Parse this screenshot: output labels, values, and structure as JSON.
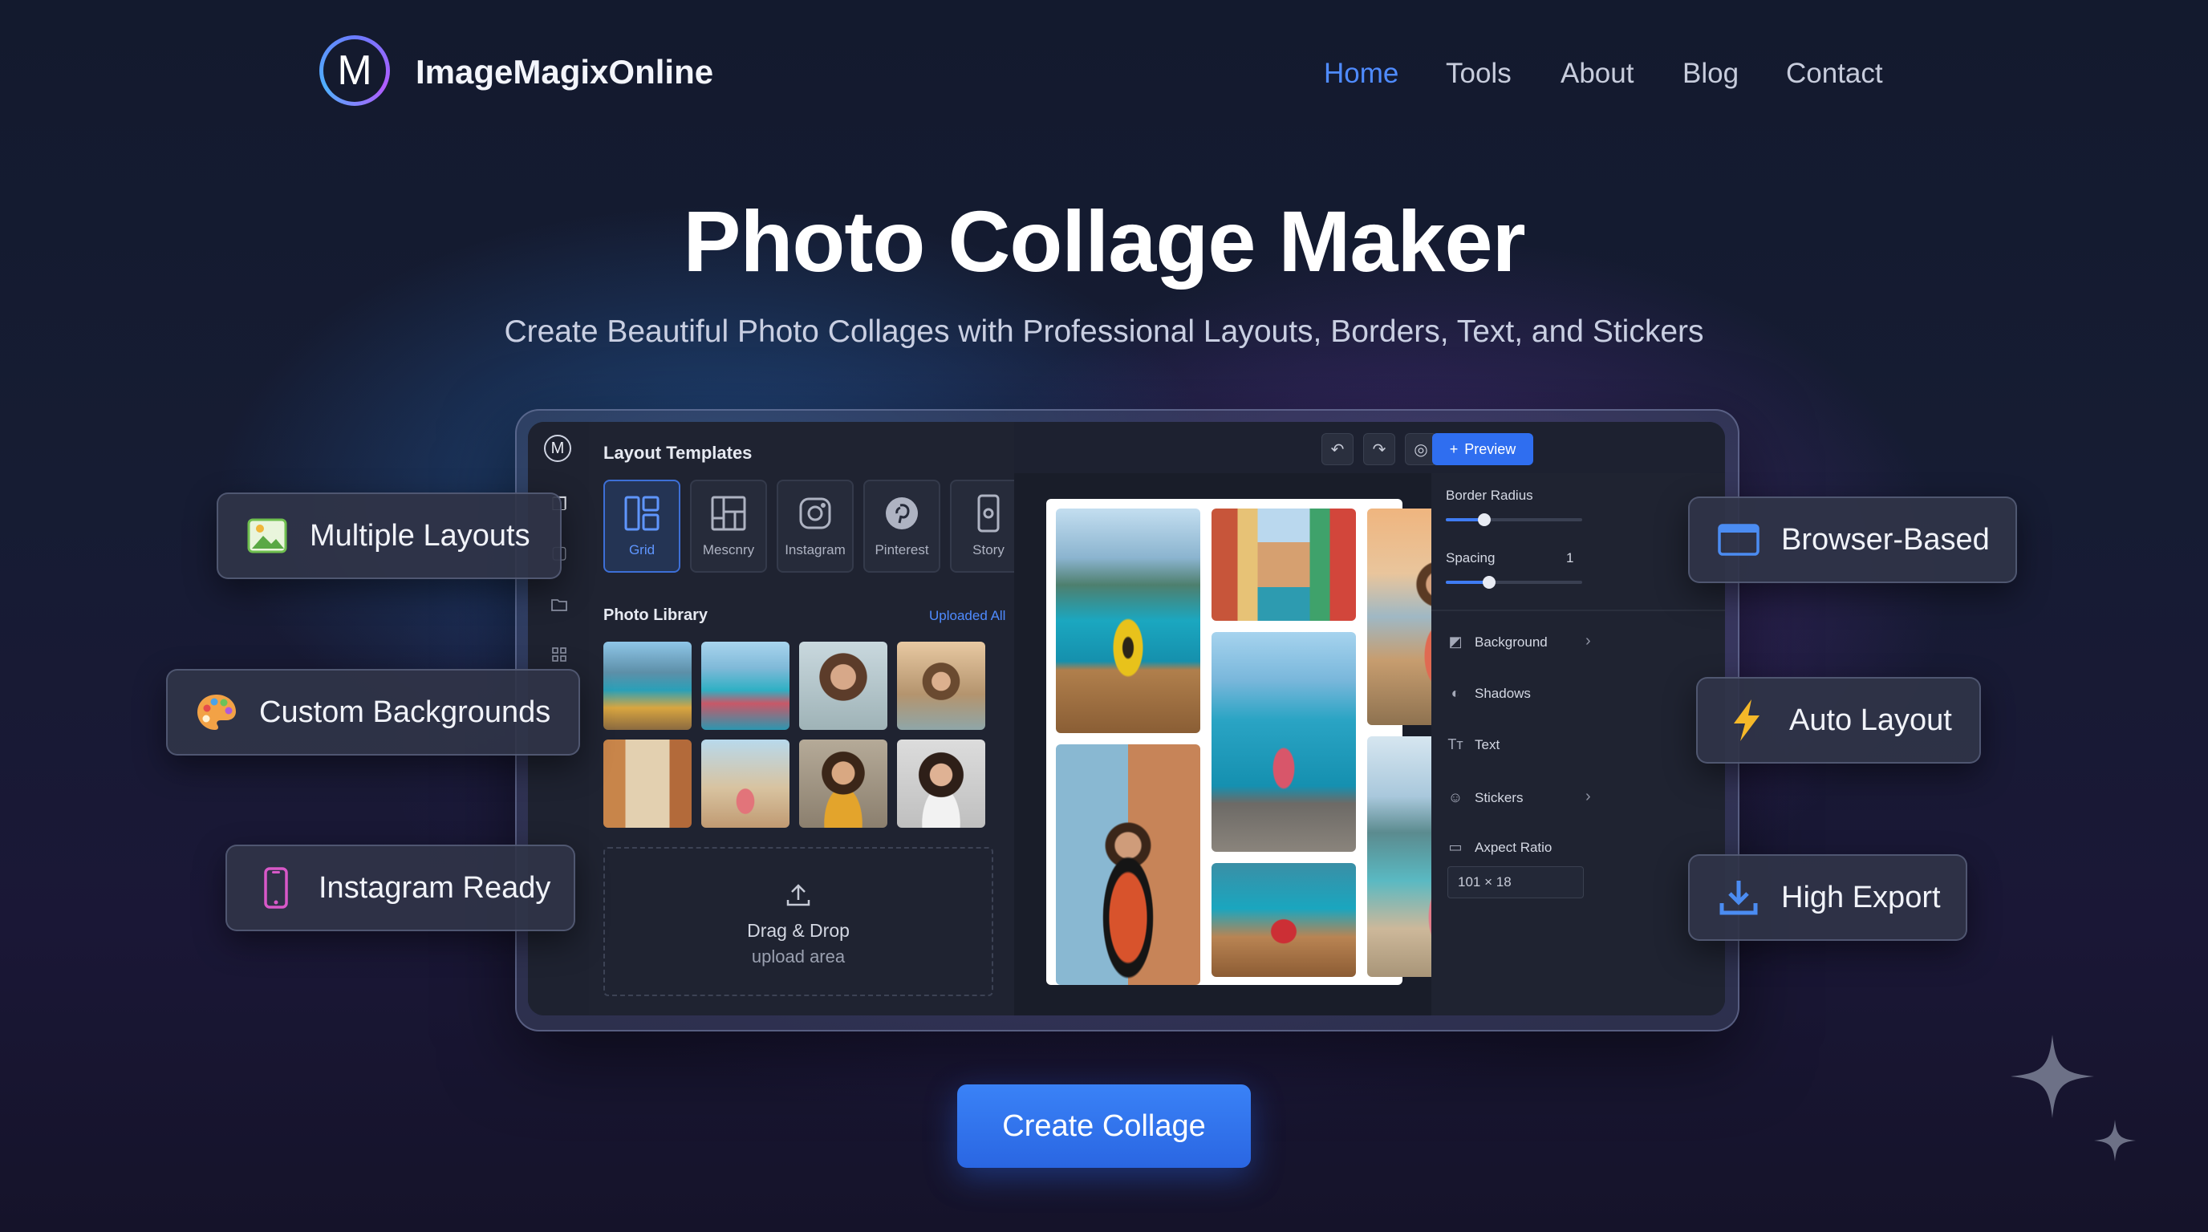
{
  "header": {
    "logo_letter": "M",
    "brand": "ImageMagixOnline",
    "nav": [
      {
        "label": "Home",
        "active": true
      },
      {
        "label": "Tools",
        "active": false
      },
      {
        "label": "About",
        "active": false
      },
      {
        "label": "Blog",
        "active": false
      },
      {
        "label": "Contact",
        "active": false
      }
    ]
  },
  "hero": {
    "title": "Photo Collage Maker",
    "subtitle": "Create Beautiful Photo Collages with Professional Layouts, Borders, Text, and Stickers"
  },
  "app": {
    "logo_letter": "M",
    "layout_templates": {
      "title": "Layout Templates",
      "items": [
        {
          "label": "Grid",
          "icon": "grid-icon",
          "selected": true
        },
        {
          "label": "Mescnry",
          "icon": "masonry-icon",
          "selected": false
        },
        {
          "label": "Instagram",
          "icon": "instagram-icon",
          "selected": false
        },
        {
          "label": "Pinterest",
          "icon": "pinterest-icon",
          "selected": false
        },
        {
          "label": "Story",
          "icon": "story-icon",
          "selected": false
        }
      ]
    },
    "photo_library": {
      "title": "Photo Library",
      "link": "Uploaded All"
    },
    "upload": {
      "line1": "Drag & Drop",
      "line2": "upload area"
    },
    "toolbar": {
      "preview_label": "Preview"
    },
    "properties": {
      "border_radius_label": "Border Radius",
      "border_radius_level": 0.28,
      "spacing_label": "Spacing",
      "spacing_value_partial": "1",
      "spacing_level": 0.32,
      "rows": [
        {
          "label": "Background",
          "icon": "background-icon",
          "chevron": true
        },
        {
          "label": "Shadows",
          "icon": "shadows-icon",
          "chevron": false
        },
        {
          "label": "Text",
          "icon": "text-icon",
          "chevron": false
        },
        {
          "label": "Stickers",
          "icon": "stickers-icon",
          "chevron": true
        }
      ],
      "aspect_label": "Axpect Ratio",
      "aspect_value": "101 × 18"
    }
  },
  "features": {
    "multiple_layouts": "Multiple Layouts",
    "custom_backgrounds": "Custom Backgrounds",
    "instagram_ready": "Instagram Ready",
    "browser_based": "Browser-Based",
    "auto_layout": "Auto Layout",
    "high_export": "High Export"
  },
  "cta": {
    "label": "Create Collage"
  },
  "colors": {
    "accent": "#3a7df5",
    "background": "#161c33"
  }
}
